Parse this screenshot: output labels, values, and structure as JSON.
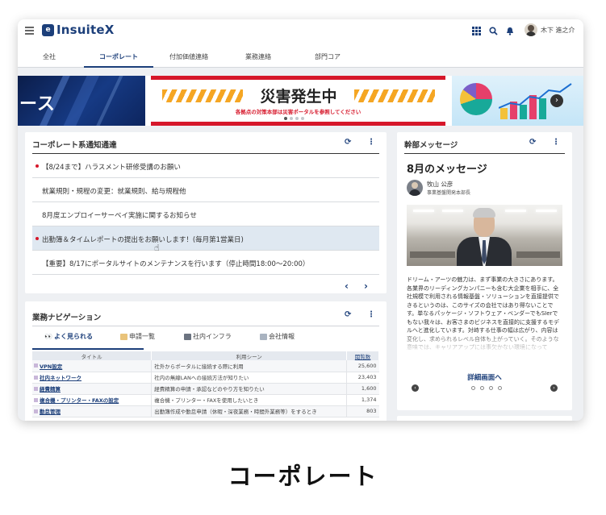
{
  "app": {
    "name": "InsuiteX",
    "logo_mark": "e"
  },
  "header": {
    "user_name": "木下 進之介",
    "icons": [
      "apps-grid-icon",
      "search-icon",
      "bell-icon"
    ]
  },
  "nav": {
    "tabs": [
      {
        "label": "全社"
      },
      {
        "label": "コーポレート",
        "active": true
      },
      {
        "label": "付加価値連絡"
      },
      {
        "label": "業務連絡"
      },
      {
        "label": "部門コア"
      }
    ]
  },
  "banner": {
    "left_text": "ース",
    "center_title": "災害発生中",
    "center_subtitle": "各拠点の対策本部は災害ポータルを参照してください",
    "colors": {
      "accent_red": "#d6172a",
      "hazard_orange": "#f5a623"
    }
  },
  "notices": {
    "title": "コーポレート系通知通達",
    "items": [
      {
        "text": "【8/24まで】ハラスメント研修受講のお願い",
        "unread": true,
        "highlight": false
      },
      {
        "text": "就業規則・規程の変更：就業規則、給与規程他",
        "unread": false,
        "highlight": false
      },
      {
        "text": "8月度エンプロイーサーベイ実施に関するお知らせ",
        "unread": false,
        "highlight": false
      },
      {
        "text": "出勤簿＆タイムレポートの提出をお願いします！(毎月第1営業日)",
        "unread": true,
        "highlight": true
      },
      {
        "text": "【重要】8/17にポータルサイトのメンテナンスを行います（停止時間18:00～20:00）",
        "unread": false,
        "highlight": false
      }
    ]
  },
  "navi": {
    "title": "業務ナビゲーション",
    "tabs": [
      {
        "label": "よく見られる",
        "active": true
      },
      {
        "label": "申請一覧"
      },
      {
        "label": "社内インフラ"
      },
      {
        "label": "会社情報"
      }
    ],
    "columns": {
      "title": "タイトル",
      "scene": "利用シーン",
      "views": "閲覧数"
    },
    "rows": [
      {
        "title": "VPN設定",
        "scene": "社外からポータルに接続する際に利用",
        "views": "25,600"
      },
      {
        "title": "社内ネットワーク",
        "scene": "社内の無線LANへの接続方法が知りたい",
        "views": "23,403"
      },
      {
        "title": "経費精算",
        "scene": "経費精算の申請・承認などのやり方を知りたい",
        "views": "1,600"
      },
      {
        "title": "複合機・プリンター・FAXの設定",
        "scene": "複合機・プリンター・FAXを使用したいとき",
        "views": "1,374"
      },
      {
        "title": "勤怠管理",
        "scene": "出勤簿作成や勤怠申請（休暇・深夜業務・時間外業務等）をするとき",
        "views": "803"
      }
    ]
  },
  "message": {
    "title": "幹部メッセージ",
    "heading": "8月のメッセージ",
    "author_name": "牧山 公彦",
    "author_title": "事業基盤開発本部長",
    "body": "ドリーム・アーツの魅力は、まず事業の大きさにあります。各業界のリーディングカンパニーも含む大企業を相手に、全社規模で利用される情報基盤・ソリューションを直接提供できるというのは、このサイズの会社ではあり得ないことです。単なるパッケージ・ソフトウェア・ベンダーでもSIerでもない我々は、お客さまのビジネスを直接的に支援するモデルへと進化しています。対峙する仕事の幅は広がり、内容は変化し、求められるレベル自体も上がっていく。そのような意味では、キャリアアップには事欠かない環境になって",
    "detail_link": "詳細画面へ"
  },
  "caption": "コーポレート"
}
